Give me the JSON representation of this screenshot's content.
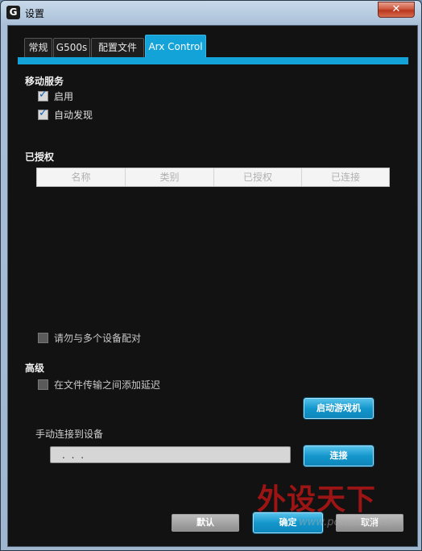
{
  "window": {
    "title": "设置",
    "close_glyph": "✕",
    "app_icon_glyph": "G"
  },
  "tabs": [
    {
      "label": "常规",
      "active": false
    },
    {
      "label": "G500s",
      "active": false
    },
    {
      "label": "配置文件",
      "active": false
    },
    {
      "label": "Arx Control",
      "active": true
    }
  ],
  "mobile_service": {
    "title": "移动服务",
    "enable": {
      "label": "启用",
      "checked": true
    },
    "auto_discover": {
      "label": "自动发现",
      "checked": true
    }
  },
  "authorized": {
    "title": "已授权",
    "columns": [
      "名称",
      "类别",
      "已授权",
      "已连接"
    ],
    "rows": []
  },
  "no_multi_pair": {
    "label": "请勿与多个设备配对",
    "checked": false
  },
  "advanced": {
    "title": "高级",
    "add_delay": {
      "label": "在文件传输之间添加延迟",
      "checked": false
    },
    "launch_game_button": "启动游戏机"
  },
  "manual_connect": {
    "label": "手动连接到设备",
    "ip_value": ". . .",
    "connect_button": "连接"
  },
  "footer": {
    "default_button": "默认",
    "ok_button": "确定",
    "cancel_button": "取消"
  },
  "watermark": {
    "text": "外设天下",
    "url": "www.pcwaishe.cn"
  },
  "colors": {
    "accent": "#14a3d9",
    "panel": "#121212"
  }
}
